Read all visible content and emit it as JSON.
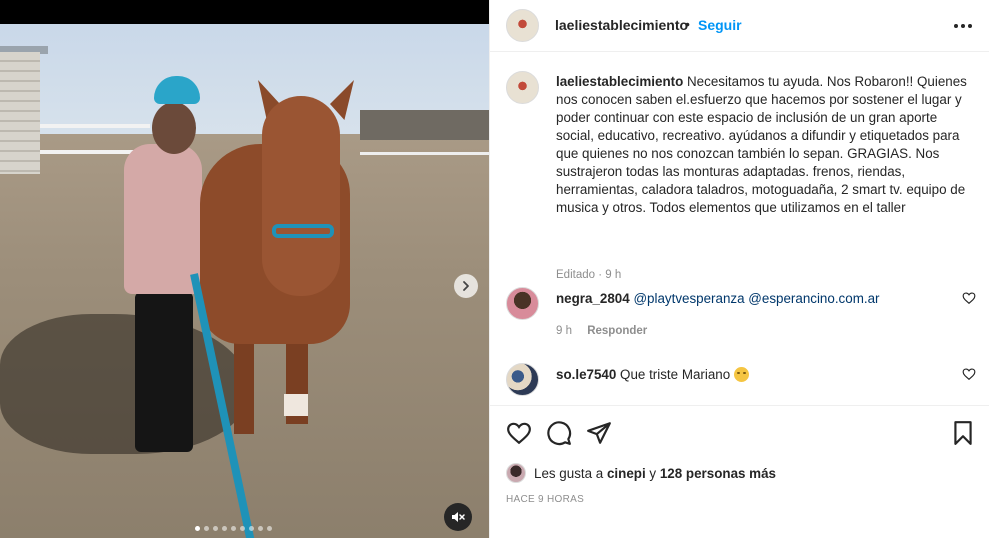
{
  "post": {
    "username": "laeliestablecimiento",
    "separator": "•",
    "follow_label": "Seguir",
    "more_icon": "more-icon"
  },
  "caption": {
    "username": "laeliestablecimiento",
    "text": "Necesitamos tu ayuda. Nos Robaron!! Quienes nos conocen saben el.esfuerzo que hacemos por sostener el lugar y poder continuar con este espacio de inclusión de un gran aporte social, educativo, recreativo. ayúdanos a difundir y etiquetados para que quienes no nos conozcan también lo sepan. GRAGIAS. Nos sustrajeron todas las monturas adaptadas. frenos, riendas, herramientas, caladora taladros, motoguadaña, 2 smart tv. equipo de musica y otros. Todos elementos que utilizamos en el taller",
    "edited_label": "Editado",
    "dot": "·",
    "time": "9 h"
  },
  "comments": [
    {
      "username": "negra_2804",
      "mention1": "@playtvesperanza",
      "mention2": "@esperancino.com.ar",
      "time": "9 h",
      "reply_label": "Responder"
    },
    {
      "username": "so.le7540",
      "text": "Que triste Mariano"
    }
  ],
  "actions": {
    "like_icon": "heart-icon",
    "comment_icon": "comment-icon",
    "share_icon": "share-icon",
    "save_icon": "bookmark-icon"
  },
  "likes": {
    "prefix": "Les gusta a",
    "user": "cinepi",
    "conj": "y",
    "others": "128 personas más"
  },
  "time_ago": "HACE 9 HORAS",
  "media": {
    "carousel_total": 9,
    "carousel_active_index": 0
  }
}
